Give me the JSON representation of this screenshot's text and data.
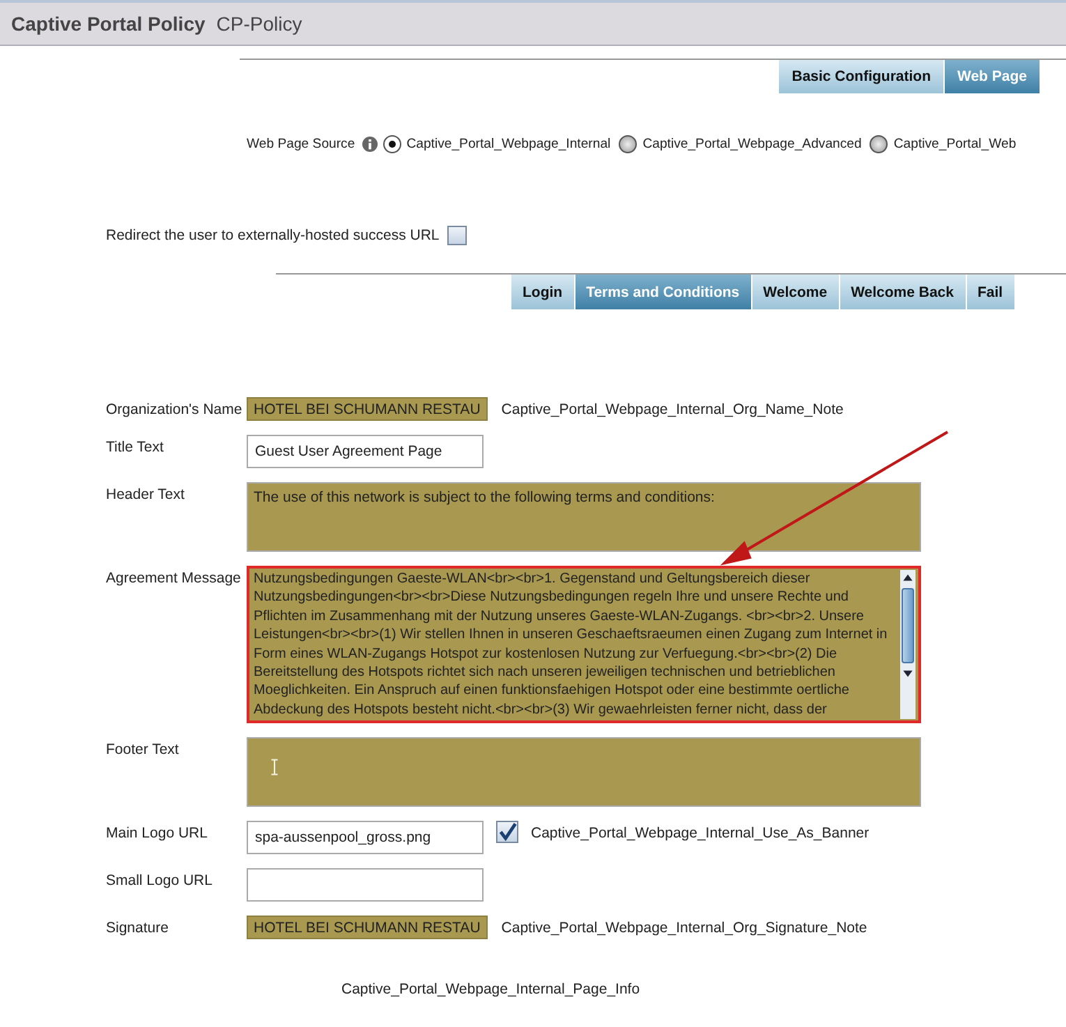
{
  "header": {
    "title": "Captive Portal Policy",
    "subtitle": "CP-Policy"
  },
  "top_tabs": [
    {
      "label": "Basic Configuration",
      "selected": false
    },
    {
      "label": "Web Page",
      "selected": true
    }
  ],
  "web_page_source": {
    "label": "Web Page Source",
    "options": [
      {
        "label": "Captive_Portal_Webpage_Internal",
        "selected": true
      },
      {
        "label": "Captive_Portal_Webpage_Advanced",
        "selected": false
      },
      {
        "label": "Captive_Portal_Web",
        "selected": false
      }
    ]
  },
  "redirect": {
    "label": "Redirect the user to externally-hosted success URL",
    "checked": false
  },
  "page_tabs": [
    {
      "label": "Login",
      "selected": false
    },
    {
      "label": "Terms and Conditions",
      "selected": true
    },
    {
      "label": "Welcome",
      "selected": false
    },
    {
      "label": "Welcome Back",
      "selected": false
    },
    {
      "label": "Fail",
      "selected": false
    }
  ],
  "fields": [
    {
      "kind": "short",
      "label": "Organization's Name",
      "value": "HOTEL BEI SCHUMANN RESTAU",
      "highlighted": true,
      "note": "Captive_Portal_Webpage_Internal_Org_Name_Note"
    },
    {
      "kind": "input",
      "label": "Title Text",
      "value": "Guest User Agreement Page",
      "highlighted": false
    },
    {
      "kind": "textarea",
      "label": "Header Text",
      "value": "The use of this network is subject to the following terms and conditions:",
      "highlighted": true
    },
    {
      "kind": "scrollarea",
      "label": "Agreement Message",
      "value": "Nutzungsbedingungen Gaeste-WLAN<br><br>1. Gegenstand und Geltungsbereich dieser Nutzungsbedingungen<br><br>Diese Nutzungsbedingungen regeln Ihre und unsere Rechte und Pflichten im Zusammenhang mit der Nutzung unseres Gaeste-WLAN-Zugangs. <br><br>2. Unsere Leistungen<br><br>(1) Wir stellen Ihnen in unseren Geschaeftsraeumen einen Zugang zum Internet in Form eines WLAN-Zugangs Hotspot zur kostenlosen Nutzung zur Verfuegung.<br><br>(2) Die Bereitstellung des Hotspots richtet sich nach unseren jeweiligen technischen und betrieblichen Moeglichkeiten. Ein Anspruch auf einen funktionsfaehigen Hotspot oder eine bestimmte oertliche Abdeckung des Hotspots besteht nicht.<br><br>(3) Wir gewaehrleisten ferner nicht, dass der",
      "highlighted": true,
      "error": true
    },
    {
      "kind": "textarea",
      "label": "Footer Text",
      "highlighted": true
    },
    {
      "kind": "input",
      "label": "Main Logo URL",
      "value": "spa-aussenpool_gross.png",
      "highlighted": false,
      "option": {
        "label": "Captive_Portal_Webpage_Internal_Use_As_Banner",
        "checked": true
      }
    },
    {
      "kind": "input",
      "label": "Small Logo URL",
      "highlighted": false
    },
    {
      "kind": "short",
      "label": "Signature",
      "value": "HOTEL BEI SCHUMANN RESTAU",
      "highlighted": true,
      "note": "Captive_Portal_Webpage_Internal_Org_Signature_Note"
    }
  ],
  "page_info": "Captive_Portal_Webpage_Internal_Page_Info"
}
